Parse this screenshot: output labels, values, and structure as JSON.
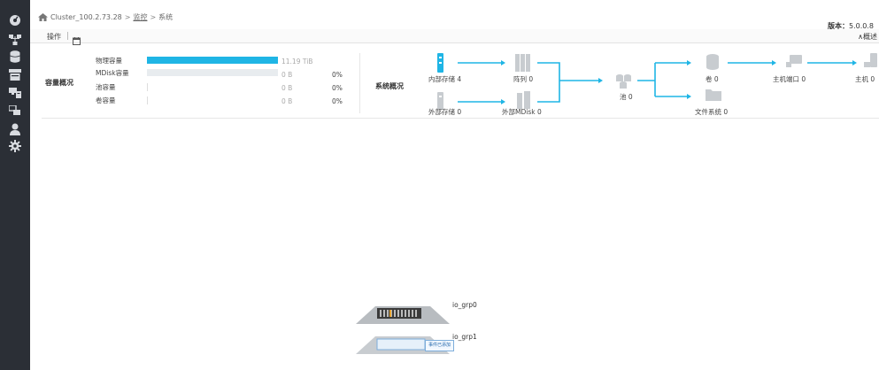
{
  "header": {
    "breadcrumb": {
      "home_icon": "home-icon",
      "cluster": "Cluster_100.2.73.28",
      "sep1": ">",
      "section": "监控",
      "sep2": ">",
      "page": "系统"
    },
    "version_label": "版本：",
    "version_value": "5.0.0.8"
  },
  "sidebar": {
    "items": [
      {
        "icon": "dashboard-icon"
      },
      {
        "icon": "network-icon"
      },
      {
        "icon": "database-icon"
      },
      {
        "icon": "volume-icon"
      },
      {
        "icon": "hosts-icon"
      },
      {
        "icon": "copy-services-icon"
      },
      {
        "icon": "user-icon"
      },
      {
        "icon": "settings-icon"
      }
    ]
  },
  "toolbar": {
    "actions_label": "操作",
    "calendar_icon": "calendar-icon",
    "collapse_label": "∧概述"
  },
  "capacity": {
    "title": "容量概况",
    "rows": [
      {
        "label": "物理容量",
        "value": "11.19 TiB",
        "percent": "",
        "fill_fraction": 1.0
      },
      {
        "label": "MDisk容量",
        "value": "0 B",
        "percent": "0%",
        "fill_fraction": 0.0
      },
      {
        "label": "池容量",
        "value": "0 B",
        "percent": "0%",
        "fill_fraction": 0.0
      },
      {
        "label": "卷容量",
        "value": "0 B",
        "percent": "0%",
        "fill_fraction": 0.0
      }
    ]
  },
  "system": {
    "title": "系统概况",
    "internal_storage": "内部存储 4",
    "external_storage": "外部存储 0",
    "array": "阵列 0",
    "external_mdisk": "外部MDisk 0",
    "pool": "池 0",
    "volume": "卷 0",
    "filesystem": "文件系统 0",
    "host_port": "主机端口 0",
    "host": "主机 0"
  },
  "io_groups": [
    {
      "label": "io_grp0"
    },
    {
      "label": "io_grp1",
      "tooltip": "事件已添加"
    }
  ],
  "colors": {
    "sidebar_bg": "#2b2f36",
    "accent": "#1fb5e5"
  }
}
